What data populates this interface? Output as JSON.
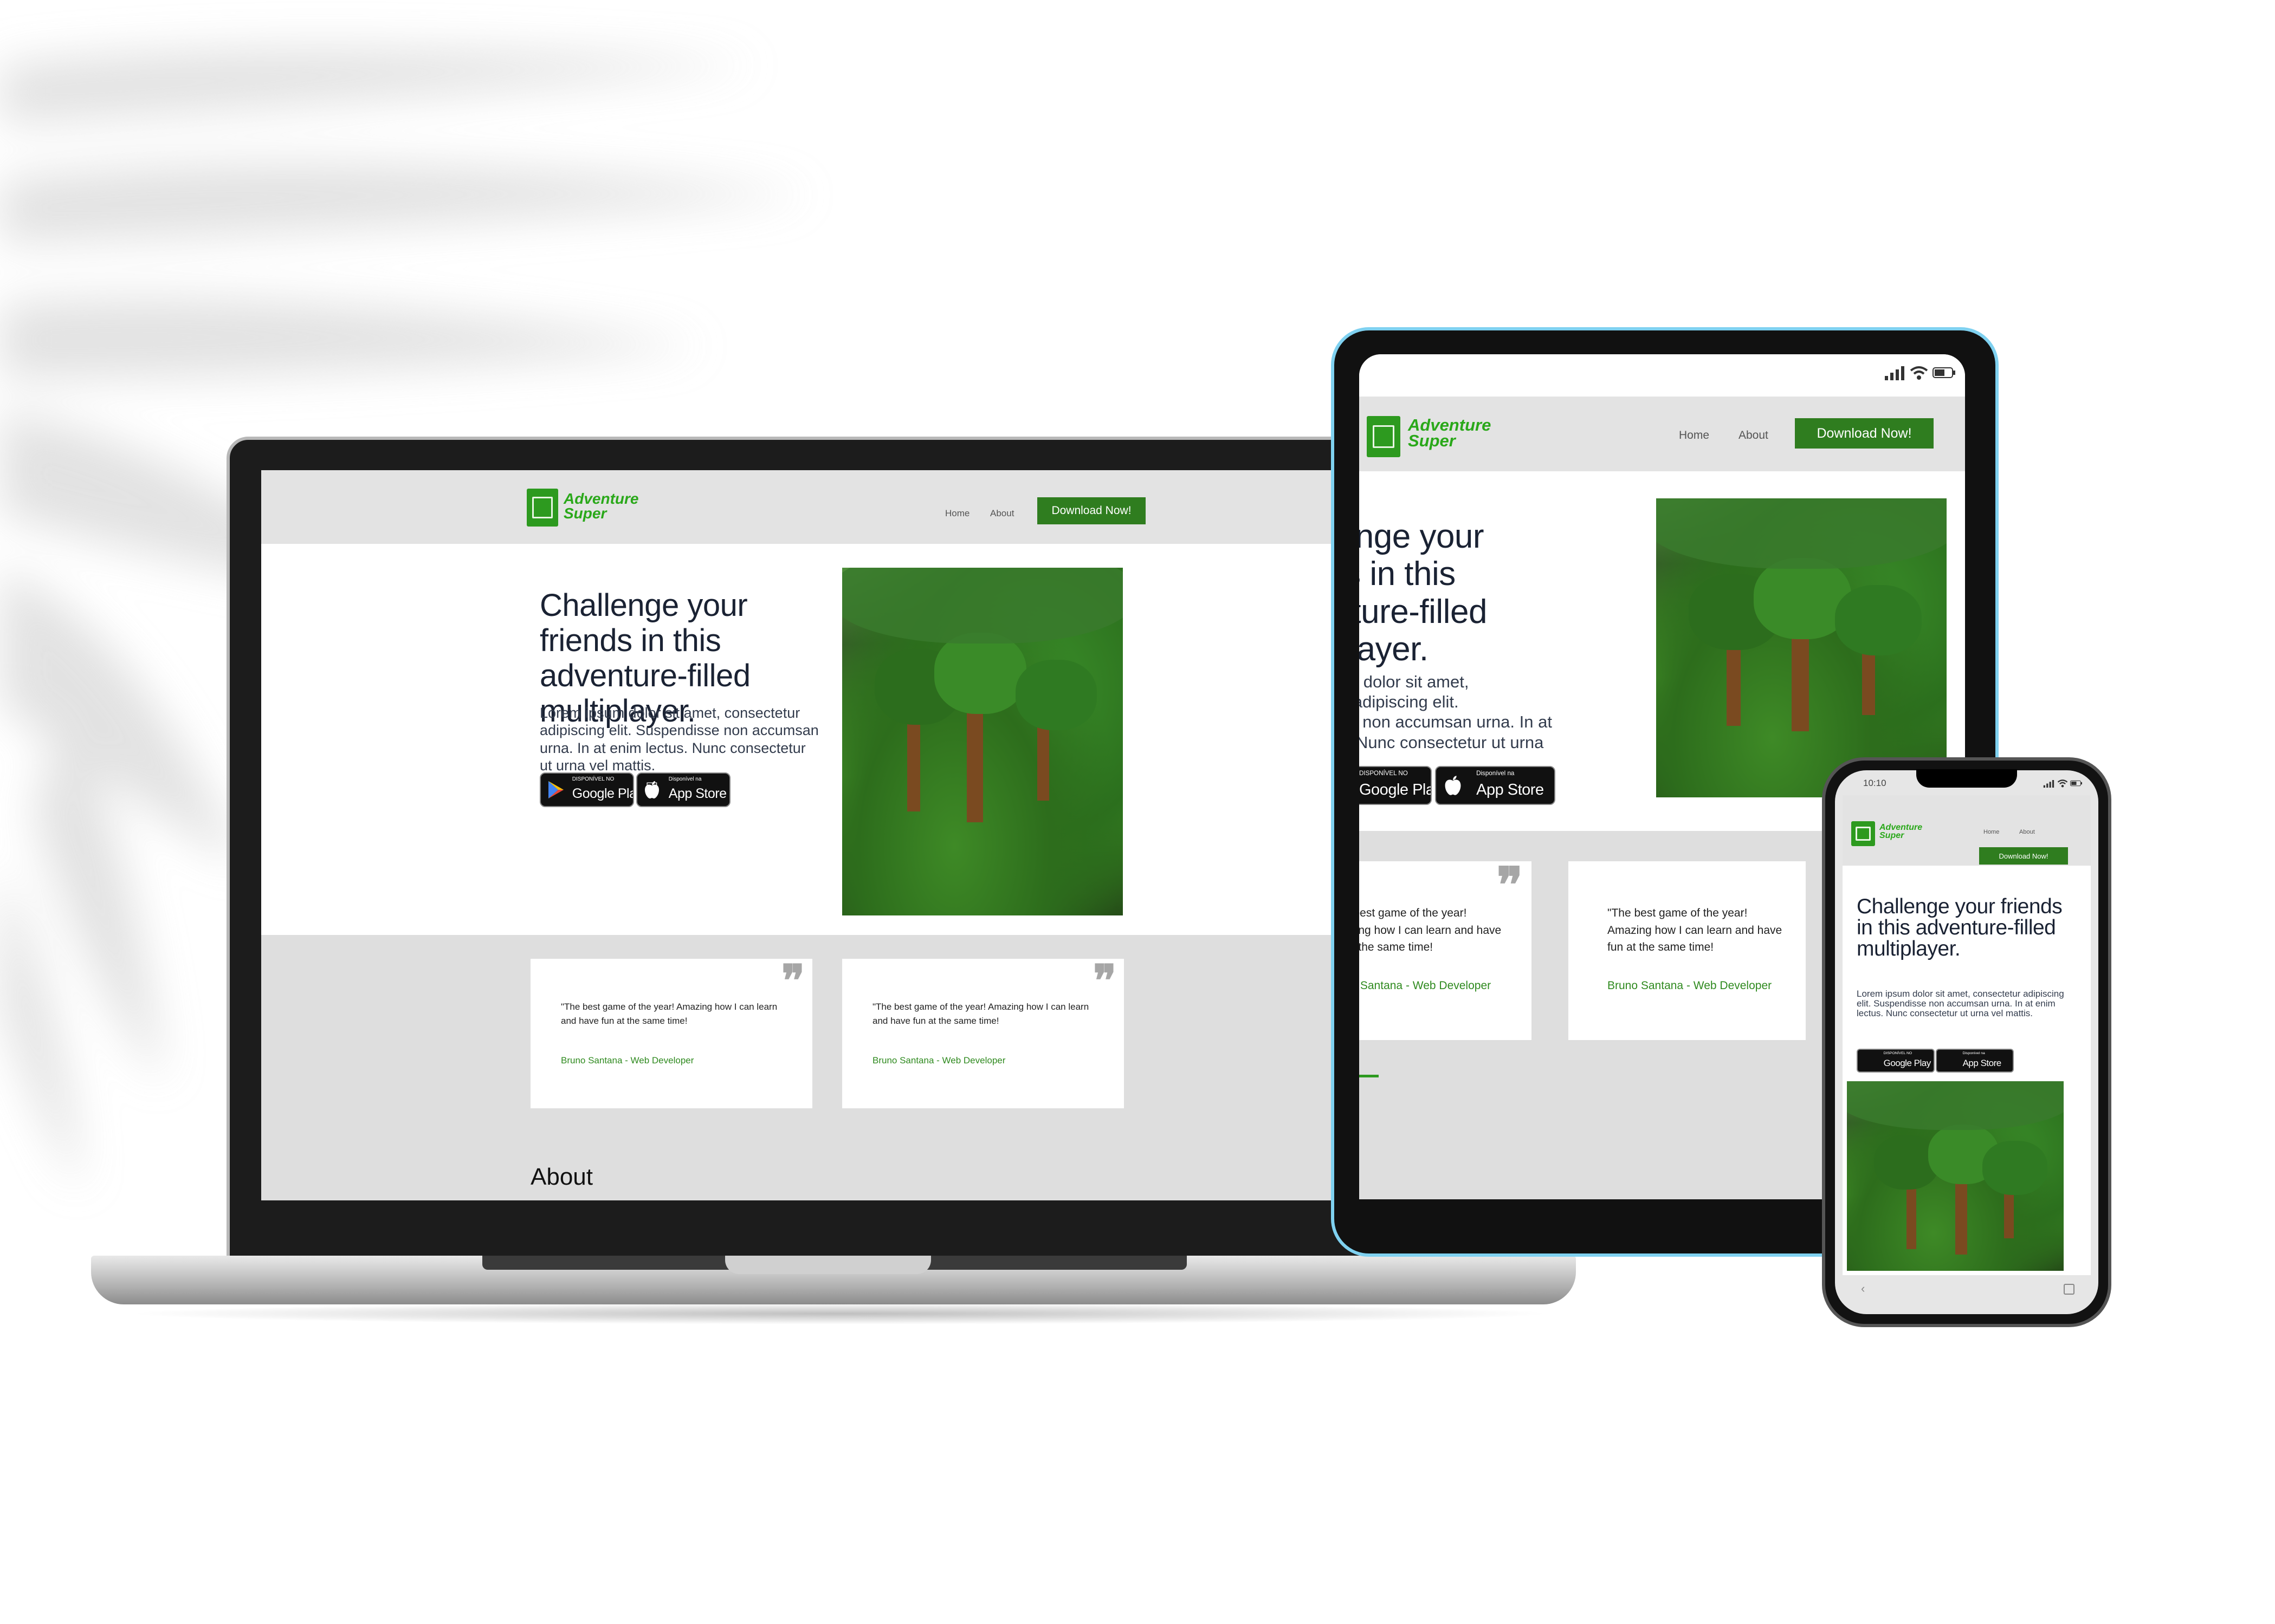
{
  "brand": {
    "name_line1": "Adventure",
    "name_line2": "Super",
    "accent": "#2d9a1f",
    "button_color": "#2f7d1f"
  },
  "nav": {
    "home": "Home",
    "about": "About",
    "download": "Download Now!"
  },
  "hero": {
    "title": "Challenge your friends in this adventure-filled multiplayer.",
    "text": "Lorem ipsum dolor sit amet, consectetur adipiscing elit. Suspendisse non accumsan urna. In at enim lectus. Nunc consectetur ut urna vel mattis."
  },
  "badges": {
    "google_small": "DISPONÍVEL NO",
    "google_big": "Google Play",
    "apple_small": "Disponível na",
    "apple_big": "App Store"
  },
  "testimonial": {
    "quote": "\"The best game of the year! Amazing how I can learn and have fun at the same time!",
    "author": "Bruno Santana - Web Developer",
    "mark": "❞"
  },
  "about": {
    "title": "About"
  },
  "phone_status": {
    "time": "10:10"
  },
  "icons": {
    "logo": "game-logo-icon",
    "google_play": "google-play-icon",
    "apple": "apple-icon",
    "quote": "quote-mark-icon",
    "signal": "signal-icon",
    "wifi": "wifi-icon",
    "battery": "battery-icon"
  }
}
